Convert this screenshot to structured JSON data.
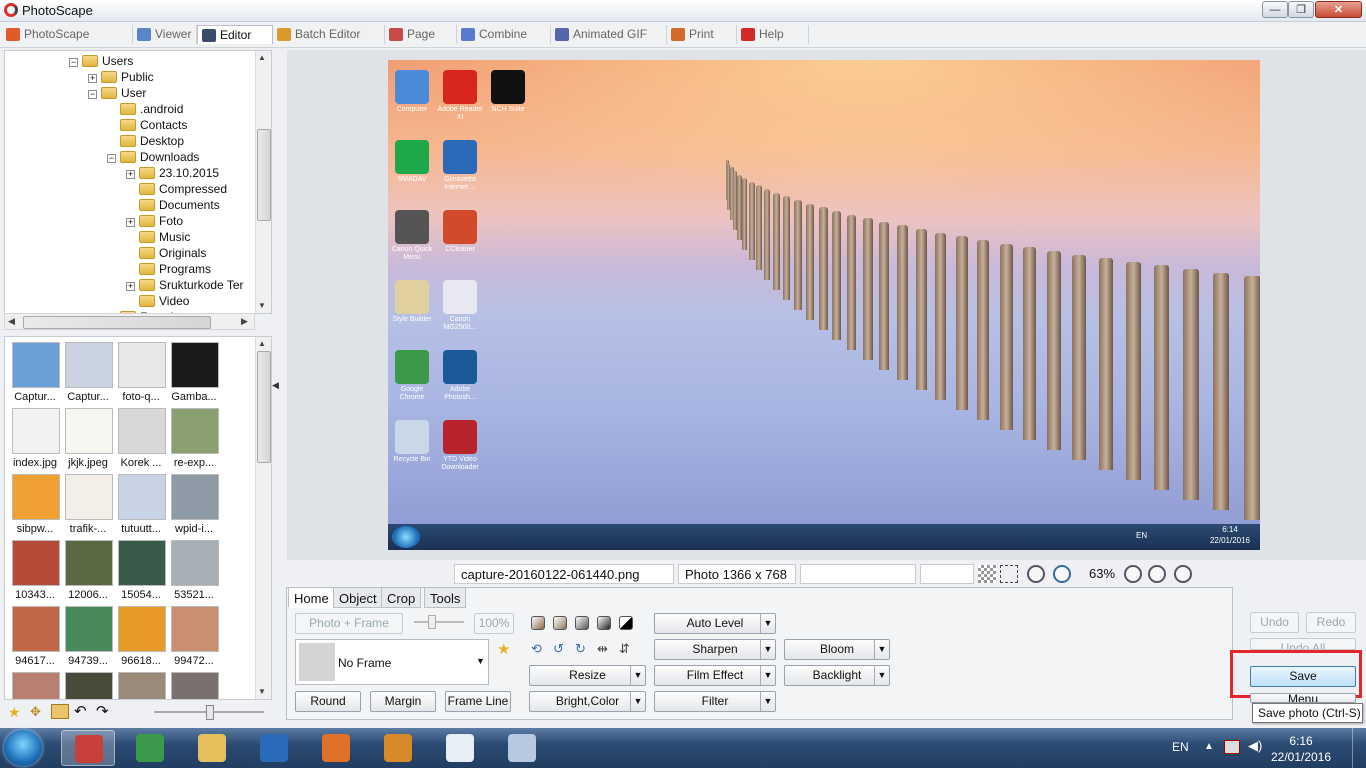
{
  "window": {
    "title": "PhotoScape",
    "min": "—",
    "max": "❐",
    "close": "✕"
  },
  "menu": [
    {
      "label": "PhotoScape",
      "color": "#e05a2a"
    },
    {
      "label": "Viewer",
      "color": "#5a86c8"
    },
    {
      "label": "Editor",
      "color": "#3a4a6a"
    },
    {
      "label": "Batch Editor",
      "color": "#d99a2c"
    },
    {
      "label": "Page",
      "color": "#c84a4a"
    },
    {
      "label": "Combine",
      "color": "#5a7ad0"
    },
    {
      "label": "Animated GIF",
      "color": "#5566aa"
    },
    {
      "label": "Print",
      "color": "#d36a2a"
    },
    {
      "label": "Help",
      "color": "#d22a2a"
    }
  ],
  "tree": [
    {
      "label": "Users",
      "level": 0,
      "exp": "-"
    },
    {
      "label": "Public",
      "level": 1,
      "exp": "+"
    },
    {
      "label": "User",
      "level": 1,
      "exp": "-"
    },
    {
      "label": ".android",
      "level": 2,
      "exp": ""
    },
    {
      "label": "Contacts",
      "level": 2,
      "exp": ""
    },
    {
      "label": "Desktop",
      "level": 2,
      "exp": ""
    },
    {
      "label": "Downloads",
      "level": 2,
      "exp": "-"
    },
    {
      "label": "23.10.2015",
      "level": 3,
      "exp": "+"
    },
    {
      "label": "Compressed",
      "level": 3,
      "exp": ""
    },
    {
      "label": "Documents",
      "level": 3,
      "exp": ""
    },
    {
      "label": "Foto",
      "level": 3,
      "exp": "+"
    },
    {
      "label": "Music",
      "level": 3,
      "exp": ""
    },
    {
      "label": "Originals",
      "level": 3,
      "exp": ""
    },
    {
      "label": "Programs",
      "level": 3,
      "exp": ""
    },
    {
      "label": "Srukturkode Ter",
      "level": 3,
      "exp": "+"
    },
    {
      "label": "Video",
      "level": 3,
      "exp": ""
    },
    {
      "label": "Favorites",
      "level": 2,
      "exp": ""
    }
  ],
  "thumbnails": [
    {
      "caption": "Captur...",
      "color": "#6aa0d8"
    },
    {
      "caption": "Captur...",
      "color": "#c8d2e0"
    },
    {
      "caption": "foto-q...",
      "color": "#e8e8e8"
    },
    {
      "caption": "Gamba...",
      "color": "#1a1a1a"
    },
    {
      "caption": "index.jpg",
      "color": "#f2f2f2"
    },
    {
      "caption": "jkjk.jpeg",
      "color": "#f6f6f0"
    },
    {
      "caption": "Korek ...",
      "color": "#d8d8d8"
    },
    {
      "caption": "re-exp...",
      "color": "#8aa070"
    },
    {
      "caption": "sibpw...",
      "color": "#f0a030"
    },
    {
      "caption": "trafik-...",
      "color": "#f4eee8"
    },
    {
      "caption": "tutuutt...",
      "color": "#c8d4e6"
    },
    {
      "caption": "wpid-i...",
      "color": "#8e9aa6"
    },
    {
      "caption": "10343...",
      "color": "#b84a3a"
    },
    {
      "caption": "12006...",
      "color": "#5a6a40"
    },
    {
      "caption": "15054...",
      "color": "#3a5a4a"
    },
    {
      "caption": "53521...",
      "color": "#a6aeb6"
    },
    {
      "caption": "94617...",
      "color": "#c06848"
    },
    {
      "caption": "94739...",
      "color": "#4a8a5a"
    },
    {
      "caption": "96618...",
      "color": "#e89a28"
    },
    {
      "caption": "99472...",
      "color": "#c89070"
    },
    {
      "caption": "",
      "color": "#b88070"
    },
    {
      "caption": "",
      "color": "#4a4a3a"
    },
    {
      "caption": "",
      "color": "#9a8a7a"
    },
    {
      "caption": "",
      "color": "#7a7070"
    }
  ],
  "desktop_icons": [
    {
      "label": "Computer",
      "color": "#4a8ad6"
    },
    {
      "label": "Adobe Reader XI",
      "color": "#d8261c"
    },
    {
      "label": "NCH Suite",
      "color": "#111111"
    },
    {
      "label": "SMADAV",
      "color": "#1fa84a"
    },
    {
      "label": "Glinaxetta Internet ...",
      "color": "#2a6ab8"
    },
    {
      "label": "Canon Quick Menu",
      "color": "#555555"
    },
    {
      "label": "CCleaner",
      "color": "#d24a2a"
    },
    {
      "label": "Style Builder",
      "color": "#e0d0a0"
    },
    {
      "label": "Canon MG2500...",
      "color": "#e8e8f0"
    },
    {
      "label": "Google Chrome",
      "color": "#3a9a4a"
    },
    {
      "label": "Adobe Photosh...",
      "color": "#1a5a9a"
    },
    {
      "label": "Recycle Bin",
      "color": "#c8d8e8"
    },
    {
      "label": "YTD Video Downloader",
      "color": "#b8242a"
    }
  ],
  "photo_taskbar": {
    "lang": "EN",
    "time": "6:14",
    "date": "22/01/2016"
  },
  "status": {
    "filename": "capture-20160122-061440.png",
    "dimensions": "Photo 1366 x 768",
    "zoom": "63%"
  },
  "panel": {
    "tabs": [
      "Home",
      "Object",
      "Crop",
      "Tools"
    ],
    "photo_frame": "Photo + Frame",
    "opacity": "100%",
    "frame": "No Frame",
    "round": "Round",
    "margin": "Margin",
    "frame_line": "Frame Line",
    "resize": "Resize",
    "bright_color": "Bright,Color",
    "auto_level": "Auto Level",
    "sharpen": "Sharpen",
    "film_effect": "Film Effect",
    "filter": "Filter",
    "bloom": "Bloom",
    "backlight": "Backlight"
  },
  "right": {
    "undo": "Undo",
    "redo": "Redo",
    "undo_all": "Undo All",
    "save": "Save",
    "menu": "Menu",
    "tooltip": "Save photo (Ctrl-S)"
  },
  "taskbar": {
    "items": [
      {
        "name": "photoscape",
        "color": "#c8403a",
        "active": true
      },
      {
        "name": "chrome",
        "color": "#3a9a4a",
        "active": false
      },
      {
        "name": "explorer",
        "color": "#e6c05a",
        "active": false
      },
      {
        "name": "tim",
        "color": "#2a6ab8",
        "active": false
      },
      {
        "name": "firefox",
        "color": "#e0702a",
        "active": false
      },
      {
        "name": "media",
        "color": "#d88a2a",
        "active": false
      },
      {
        "name": "viewer",
        "color": "#e8eef6",
        "active": false
      },
      {
        "name": "paint",
        "color": "#b8c8e0",
        "active": false
      }
    ],
    "lang": "EN",
    "time": "6:16",
    "date": "22/01/2016"
  }
}
